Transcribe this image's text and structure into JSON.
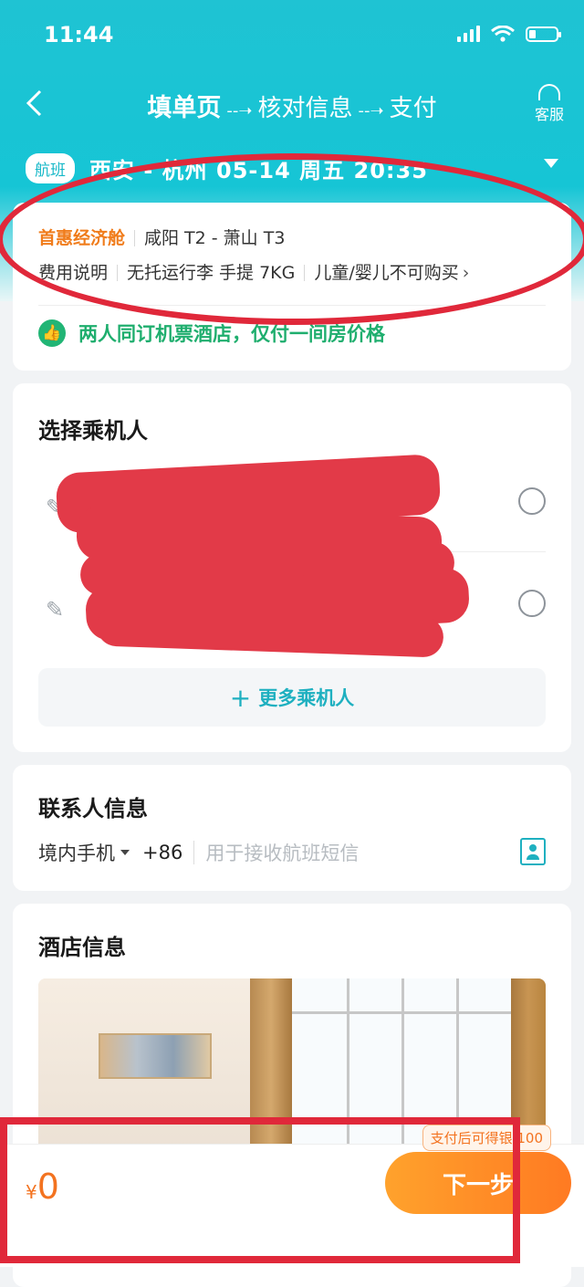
{
  "status_bar": {
    "time": "11:44"
  },
  "header": {
    "steps": [
      "填单页",
      "核对信息",
      "支付"
    ],
    "arrow": "--➝",
    "service_label": "客服"
  },
  "flight": {
    "tag": "航班",
    "route": "西安 - 杭州 05-14 周五 20:35"
  },
  "cabin": {
    "name": "首惠经济舱",
    "airports": "咸阳 T2 - 萧山 T3",
    "rules": [
      "费用说明",
      "无托运行李 手提 7KG",
      "儿童/婴儿不可购买"
    ],
    "promo": "两人同订机票酒店，仅付一间房价格"
  },
  "passengers": {
    "title": "选择乘机人",
    "more_label": "更多乘机人"
  },
  "contact": {
    "title": "联系人信息",
    "type": "境内手机",
    "country_code": "+86",
    "placeholder": "用于接收航班短信"
  },
  "hotel": {
    "title": "酒店信息"
  },
  "bottom": {
    "currency": "¥",
    "price": "0",
    "tip": "支付后可得银 100",
    "next_label": "下一步"
  },
  "colors": {
    "header_teal": "#1fc3d3",
    "accent_orange": "#f37320",
    "promo_green": "#1fae6e",
    "annotation_red": "#e0283a"
  }
}
